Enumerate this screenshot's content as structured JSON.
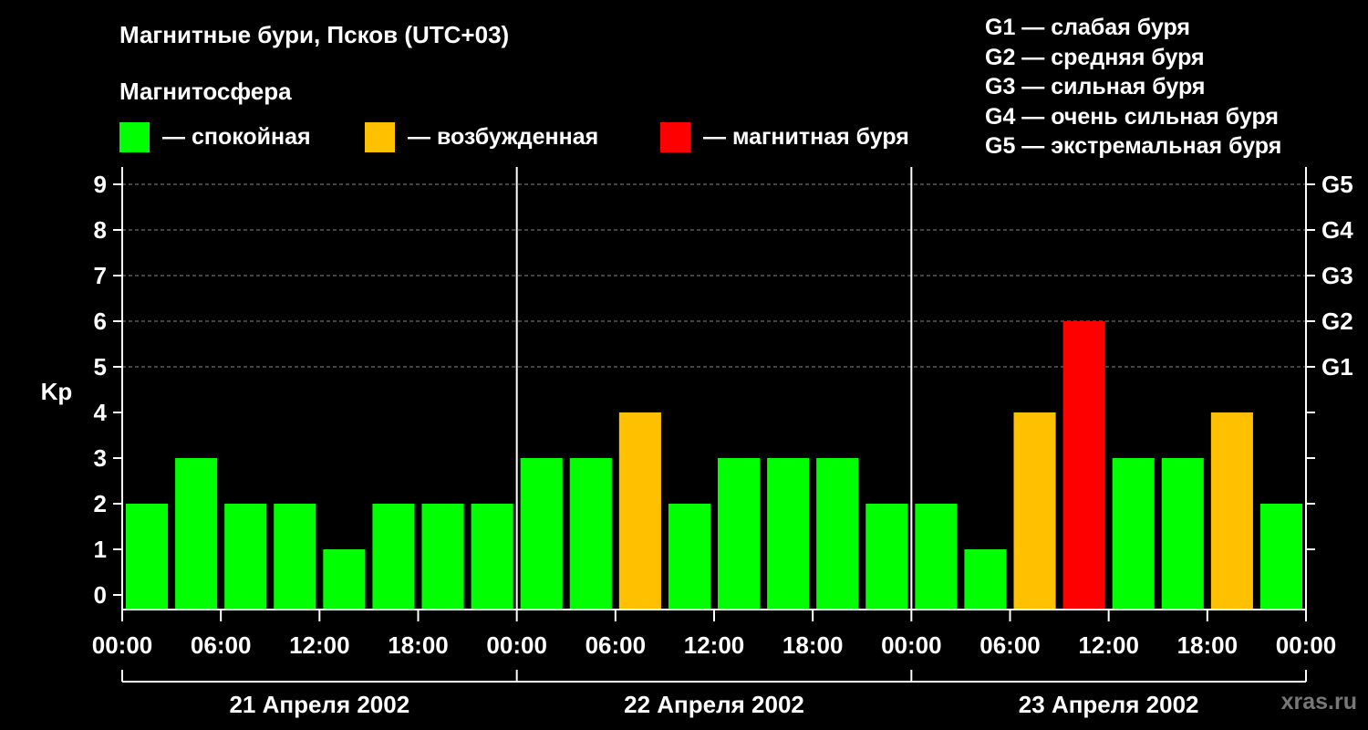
{
  "header": {
    "title": "Магнитные бури, Псков (UTC+03)",
    "subtitle": "Магнитосфера"
  },
  "legend": [
    {
      "label": "— спокойная",
      "color": "#00ff00"
    },
    {
      "label": "— возбужденная",
      "color": "#ffc000"
    },
    {
      "label": "— магнитная буря",
      "color": "#ff0000"
    }
  ],
  "g_legend": [
    "G1 — слабая буря",
    "G2 — средняя буря",
    "G3 — сильная буря",
    "G4 — очень сильная буря",
    "G5 — экстремальная буря"
  ],
  "watermark": "xras.ru",
  "colors": {
    "quiet": "#00ff00",
    "active": "#ffc000",
    "storm": "#ff0000",
    "background": "#000000",
    "axis": "#ffffff",
    "grid": "#888888"
  },
  "chart_data": {
    "type": "bar",
    "ylabel": "Kp",
    "ylim": [
      0,
      9
    ],
    "yticks": [
      "0",
      "1",
      "2",
      "3",
      "4",
      "5",
      "6",
      "7",
      "8",
      "9"
    ],
    "right_ticks": [
      {
        "value": 5,
        "label": "G1"
      },
      {
        "value": 6,
        "label": "G2"
      },
      {
        "value": 7,
        "label": "G3"
      },
      {
        "value": 8,
        "label": "G4"
      },
      {
        "value": 9,
        "label": "G5"
      }
    ],
    "grid": "horizontal dashed at 5-9",
    "xticks": [
      "00:00",
      "06:00",
      "12:00",
      "18:00",
      "00:00",
      "06:00",
      "12:00",
      "18:00",
      "00:00",
      "06:00",
      "12:00",
      "18:00",
      "00:00"
    ],
    "days": [
      "21 Апреля 2002",
      "22 Апреля 2002",
      "23 Апреля 2002"
    ],
    "bar_interval_hours": 3,
    "values": [
      2,
      3,
      2,
      2,
      1,
      2,
      2,
      2,
      3,
      3,
      4,
      2,
      3,
      3,
      3,
      2,
      2,
      1,
      4,
      6,
      3,
      3,
      4,
      2
    ],
    "levels": [
      "quiet",
      "quiet",
      "quiet",
      "quiet",
      "quiet",
      "quiet",
      "quiet",
      "quiet",
      "quiet",
      "quiet",
      "active",
      "quiet",
      "quiet",
      "quiet",
      "quiet",
      "quiet",
      "quiet",
      "quiet",
      "active",
      "storm",
      "quiet",
      "quiet",
      "active",
      "quiet"
    ]
  }
}
